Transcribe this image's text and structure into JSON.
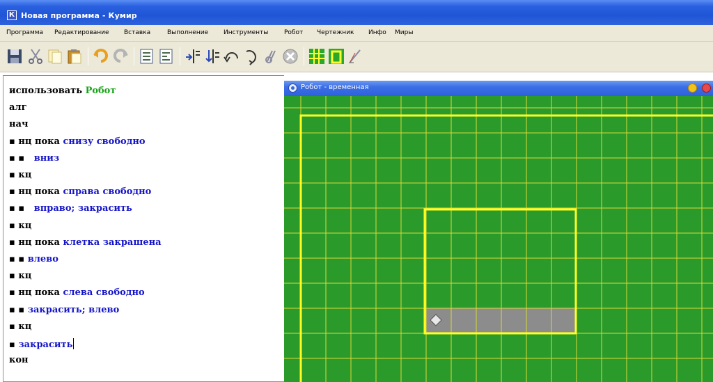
{
  "window": {
    "title": "Новая программа - Кумир",
    "app_icon_letter": "К"
  },
  "menu": {
    "items": [
      "Программа",
      "Редактирование",
      "Вставка",
      "Выполнение",
      "Инструменты",
      "Робот",
      "Чертежник",
      "Инфо",
      "Миры"
    ]
  },
  "toolbar": {
    "icons": [
      "save-icon",
      "cut-icon",
      "copy-icon",
      "paste-icon",
      "undo-icon",
      "redo-icon",
      "insert-line-icon",
      "delete-line-icon",
      "step-in-icon",
      "step-out-icon",
      "run-step-icon",
      "run-icon",
      "watch-icon",
      "stop-icon",
      "robot-field-icon",
      "robot-window-icon",
      "draftsman-icon"
    ]
  },
  "editor": {
    "lines": [
      [
        {
          "t": "использовать ",
          "c": "kw"
        },
        {
          "t": "Робот",
          "c": "green"
        }
      ],
      [
        {
          "t": "алг",
          "c": "kw"
        }
      ],
      [
        {
          "t": "нач",
          "c": "kw"
        }
      ],
      [
        {
          "t": "▪ нц пока ",
          "c": "kw"
        },
        {
          "t": "снизу свободно",
          "c": "blue"
        }
      ],
      [
        {
          "t": "▪ ▪   ",
          "c": "kw"
        },
        {
          "t": "вниз",
          "c": "blue"
        }
      ],
      [
        {
          "t": "▪ кц",
          "c": "kw"
        }
      ],
      [
        {
          "t": "▪ нц пока ",
          "c": "kw"
        },
        {
          "t": "справа свободно",
          "c": "blue"
        }
      ],
      [
        {
          "t": "▪ ▪   ",
          "c": "kw"
        },
        {
          "t": "вправо; закрасить",
          "c": "blue"
        }
      ],
      [
        {
          "t": "▪ кц",
          "c": "kw"
        }
      ],
      [
        {
          "t": "▪ нц пока ",
          "c": "kw"
        },
        {
          "t": "клетка закрашена",
          "c": "blue"
        }
      ],
      [
        {
          "t": "▪ ▪ ",
          "c": "kw"
        },
        {
          "t": "влево",
          "c": "blue"
        }
      ],
      [
        {
          "t": "▪ кц",
          "c": "kw"
        }
      ],
      [
        {
          "t": "▪ нц пока ",
          "c": "kw"
        },
        {
          "t": "слева свободно",
          "c": "blue"
        }
      ],
      [
        {
          "t": "▪ ▪ ",
          "c": "kw"
        },
        {
          "t": "закрасить; ",
          "c": "blue"
        },
        {
          "t": "влево",
          "c": "blue"
        }
      ],
      [
        {
          "t": "▪ кц",
          "c": "kw"
        }
      ],
      [
        {
          "t": "▪ ",
          "c": "kw"
        },
        {
          "t": "закрасить",
          "c": "blue"
        }
      ],
      [
        {
          "t": "кон",
          "c": "kw"
        }
      ]
    ],
    "cursor_line": 15
  },
  "robot_window": {
    "title": "Робот - временная",
    "colors": {
      "field": "#2a9a2a",
      "grid": "#d9d93a",
      "wall": "#ffff22",
      "painted": "#8c8c8c",
      "robot": "#e8e8e8"
    },
    "grid": {
      "cols": 17,
      "rows": 12
    },
    "painted_row": 8,
    "painted_cols": [
      5,
      6,
      7,
      8,
      9,
      10
    ],
    "robot_cell": {
      "col": 5,
      "row": 8
    }
  }
}
